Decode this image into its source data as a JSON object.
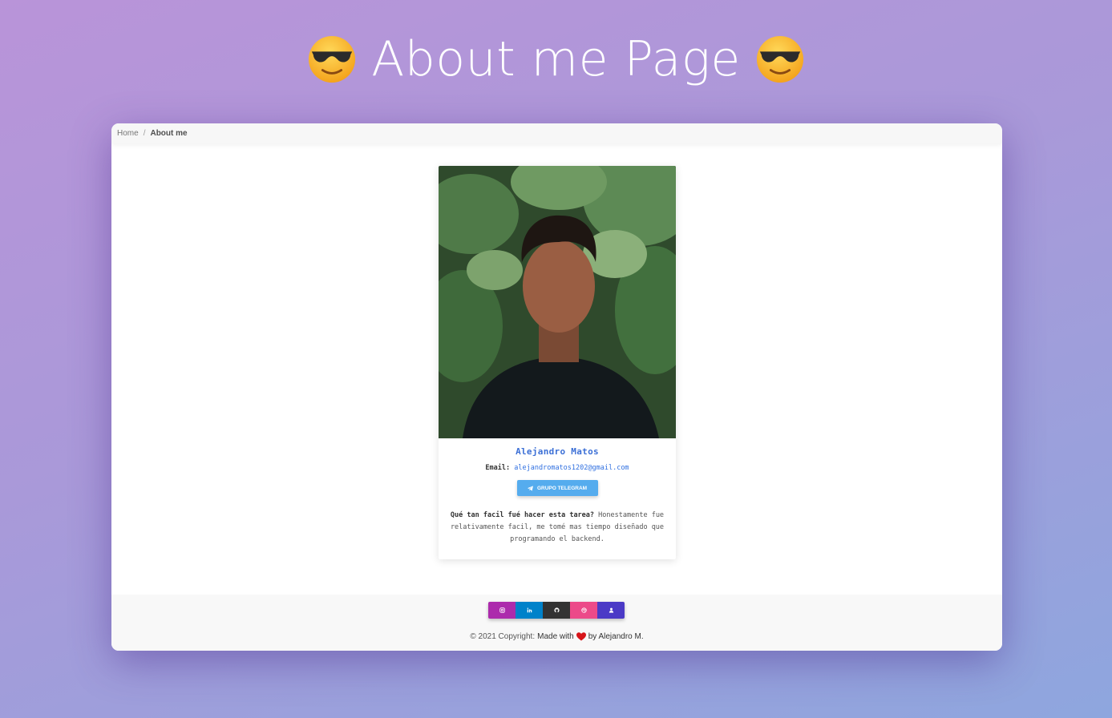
{
  "header": {
    "title": "About me Page",
    "emoji_icon": "sunglasses-face-icon"
  },
  "breadcrumb": {
    "home": "Home",
    "separator": "/",
    "current": "About me"
  },
  "profile": {
    "name": "Alejandro Matos",
    "email_label": "Email:",
    "email": "alejandromatos1202@gmail.com",
    "telegram_button": "GRUPO TELEGRAM",
    "question": "Qué tan facil fué hacer esta tarea?",
    "answer": "Honestamente fue relativamente facil, me tomé mas tiempo diseñado que programando el backend."
  },
  "footer": {
    "socials": [
      {
        "name": "instagram",
        "icon": "instagram-icon",
        "color": "#ac2bac"
      },
      {
        "name": "linkedin",
        "icon": "linkedin-icon",
        "color": "#0082ca"
      },
      {
        "name": "github",
        "icon": "github-icon",
        "color": "#333333"
      },
      {
        "name": "dribbble",
        "icon": "dribbble-icon",
        "color": "#ec4a89"
      },
      {
        "name": "profile",
        "icon": "user-icon",
        "color": "#4b3ac6"
      }
    ],
    "copyright_prefix": "© 2021 Copyright:",
    "made_with": "Made with",
    "by": "by Alejandro M."
  },
  "colors": {
    "accent_blue": "#3b6fd6",
    "telegram": "#55acee"
  }
}
